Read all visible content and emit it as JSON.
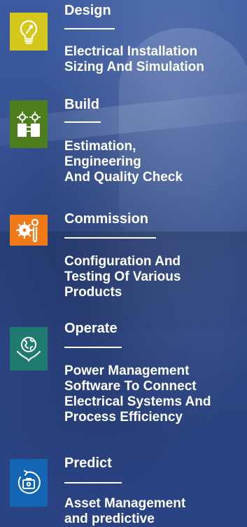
{
  "steps": [
    {
      "title": "Design",
      "description_lines": [
        "Electrical Installation",
        "Sizing And Simulation"
      ],
      "icon": "lightbulb-icon",
      "color": "#d4c81c"
    },
    {
      "title": "Build",
      "description_lines": [
        "Estimation,",
        "Engineering",
        "And Quality Check"
      ],
      "icon": "building-gears-icon",
      "color": "#4d7d1d"
    },
    {
      "title": "Commission",
      "description_lines": [
        "Configuration And",
        "Testing Of Various",
        "Products"
      ],
      "icon": "gear-wrench-icon",
      "color": "#f07a18"
    },
    {
      "title": "Operate",
      "description_lines": [
        "Power Management",
        "Software To Connect",
        "Electrical Systems And",
        "Process Efficiency"
      ],
      "icon": "globe-hands-icon",
      "color": "#1f7b6f"
    },
    {
      "title": "Predict",
      "description_lines": [
        "Asset Management",
        "and predictive"
      ],
      "icon": "toolbox-cycle-icon",
      "color": "#1466b5"
    }
  ]
}
